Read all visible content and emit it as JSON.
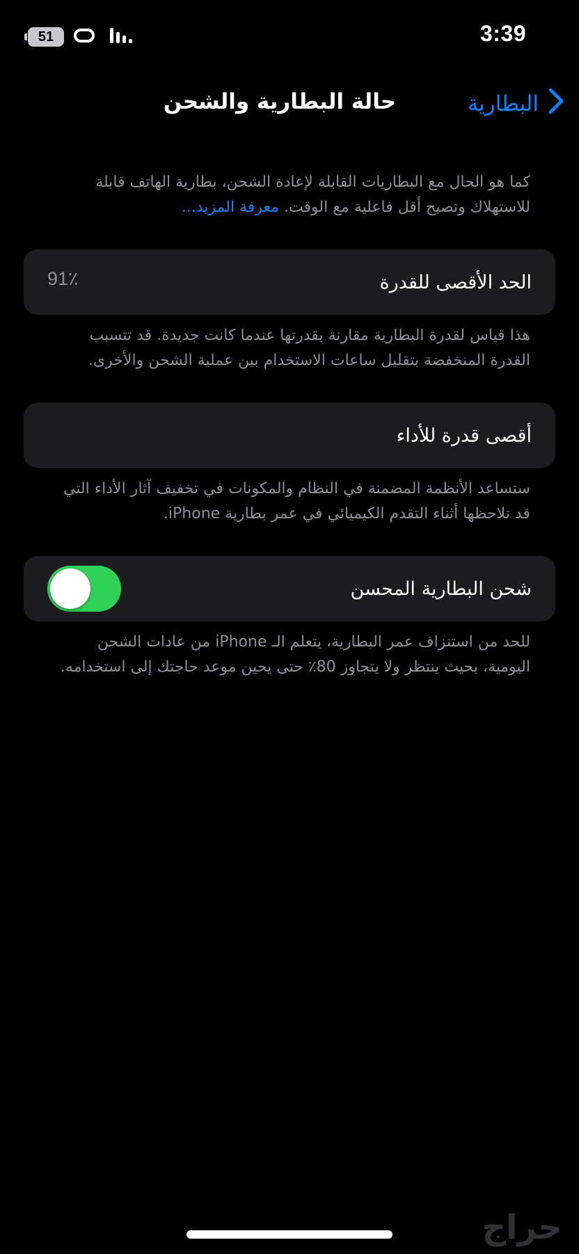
{
  "status_bar": {
    "time": "3:39",
    "battery_level": "51"
  },
  "nav": {
    "back_label": "البطارية",
    "title": "حالة البطارية والشحن"
  },
  "intro": {
    "text": "كما هو الحال مع البطاريات القابلة لإعادة الشحن، بطارية الهاتف قابلة للاستهلاك وتصبح أقل فاعلية مع الوقت.",
    "link": "معرفة المزيد..."
  },
  "max_capacity": {
    "label": "الحد الأقصى للقدرة",
    "value": "91٪",
    "footnote": "هذا قياس لقدرة البطارية مقارنة بقدرتها عندما كانت جديدة. قد تتسبب القدرة المنخفضة بتقليل ساعات الاستخدام بين عملية الشحن والأخرى."
  },
  "peak_performance": {
    "label": "أقصى قدرة للأداء",
    "footnote": "ستساعد الأنظمة المضمنة في النظام والمكونات في تخفيف آثار الأداء التي قد تلاحظها أثناء التقدم الكيميائي في عمر بطارية iPhone."
  },
  "optimized_charging": {
    "label": "شحن البطارية المحسن",
    "enabled": true,
    "footnote": "للحد من استنزاف عمر البطارية، يتعلم الـ iPhone من عادات الشحن اليومية، بحيث ينتظر ولا يتجاوز 80٪ حتى يحين موعد حاجتك إلى استخدامه."
  },
  "watermark": "حراج",
  "colors": {
    "accent": "#0a84ff",
    "toggle_on": "#30d158",
    "cell_bg": "#1c1c1e",
    "footnote": "#8e8e93"
  }
}
